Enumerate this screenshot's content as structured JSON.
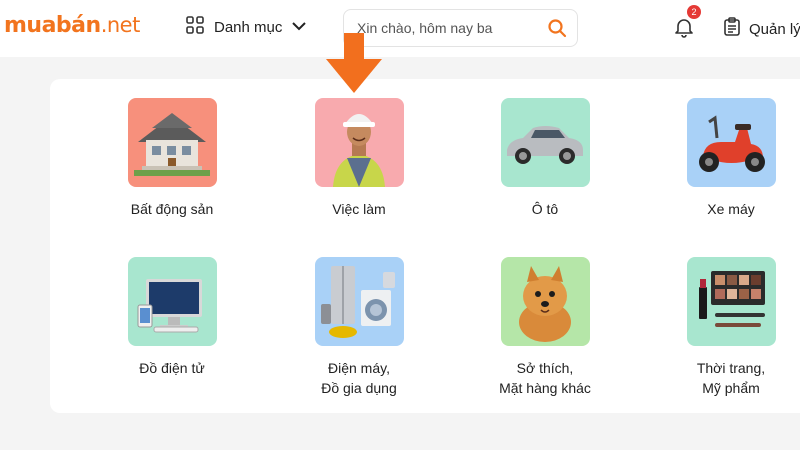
{
  "header": {
    "logo_main": "muabán",
    "logo_suffix": ".net",
    "category_label": "Danh mục",
    "search_placeholder": "Xin chào, hôm nay ba",
    "notification_count": "2",
    "manage_label": "Quản lý"
  },
  "categories": [
    {
      "line1": "Bất động sản",
      "line2": "",
      "icon": "house-icon",
      "bg": "#f7907c"
    },
    {
      "line1": "Việc làm",
      "line2": "",
      "icon": "worker-icon",
      "bg": "#f8aaae"
    },
    {
      "line1": "Ô tô",
      "line2": "",
      "icon": "car-icon",
      "bg": "#a8e6cf"
    },
    {
      "line1": "Xe máy",
      "line2": "",
      "icon": "scooter-icon",
      "bg": "#a9d1f7"
    },
    {
      "line1": "Đồ điện tử",
      "line2": "",
      "icon": "computer-icon",
      "bg": "#a8e6cf"
    },
    {
      "line1": "Điện máy,",
      "line2": "Đồ gia dụng",
      "icon": "appliances-icon",
      "bg": "#a9d1f7"
    },
    {
      "line1": "Sở thích,",
      "line2": "Mặt hàng khác",
      "icon": "dog-icon",
      "bg": "#b5e6a8"
    },
    {
      "line1": "Thời trang,",
      "line2": "Mỹ phẩm",
      "icon": "cosmetics-icon",
      "bg": "#a8e6cf"
    }
  ],
  "colors": {
    "brand": "#f2741e",
    "badge": "#e53935",
    "arrow": "#f26f1e"
  }
}
